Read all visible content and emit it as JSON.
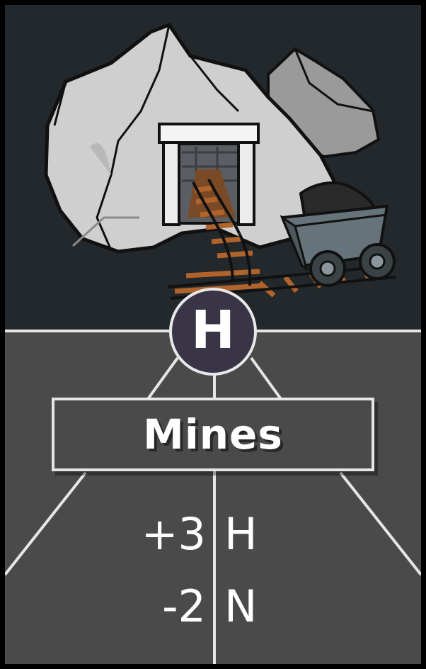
{
  "card": {
    "badge_letter": "H",
    "title": "Mines",
    "effects": [
      {
        "amount": "+3",
        "resource": "H"
      },
      {
        "amount": "-2",
        "resource": "N"
      }
    ]
  },
  "colors": {
    "art_background": "#22282b",
    "card_body": "#4a4a4a",
    "badge_fill": "#3a3447",
    "frame_lines": "#e6e6e6",
    "rail_ties": "#b0642c"
  },
  "icons": {
    "illustration": "mine-entrance-with-coal-cart",
    "badge": "letter-badge"
  }
}
